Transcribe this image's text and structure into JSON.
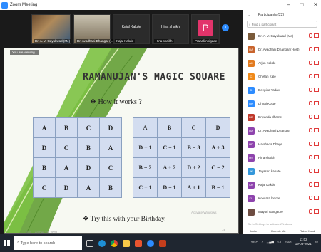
{
  "window": {
    "title": "Zoom Meeting"
  },
  "video_strip": {
    "tiles": [
      {
        "name": "Dr. A. V. Gayakwad (Me)"
      },
      {
        "name": "Dr. Avadhani Dhangar (..."
      },
      {
        "name": "Kajal Kakde",
        "caption": "Kajal Kakde"
      },
      {
        "name": "Hina shaikh",
        "caption": "Hina shaikh"
      },
      {
        "name": "Pranali nnigade",
        "avatar_letter": "P"
      }
    ]
  },
  "share_label": "You are viewing...",
  "slide": {
    "title": "RAMANUJAN'S MAGIC SQUARE",
    "subtitle": "❖ How it works ?",
    "grid_left": [
      [
        "A",
        "B",
        "C",
        "D"
      ],
      [
        "D",
        "C",
        "B",
        "A"
      ],
      [
        "B",
        "A",
        "D",
        "C"
      ],
      [
        "C",
        "D",
        "A",
        "B"
      ]
    ],
    "grid_right": [
      [
        "A",
        "B",
        "C",
        "D"
      ],
      [
        "D + 1",
        "C − 1",
        "B − 3",
        "A + 3"
      ],
      [
        "B − 2",
        "A + 2",
        "D + 2",
        "C − 2"
      ],
      [
        "C + 1",
        "D − 1",
        "A + 1",
        "B − 1"
      ]
    ],
    "footer_note": "❖ Try this with your Birthday.",
    "date": "Sat   ...  ember 19, 2021",
    "page_number": "19",
    "watermark": "Activate Windows"
  },
  "participants": {
    "header": "Participants (22)",
    "search_placeholder": "Find a participant",
    "list": [
      {
        "name": "Dr. A. V. Gayakwad (Me)",
        "initials": "",
        "color": "#7a5a3a"
      },
      {
        "name": "Dr. Avadhani Dhangar (Host)",
        "initials": "DA",
        "color": "#c8642d"
      },
      {
        "name": "Arjun Kakde",
        "initials": "AK",
        "color": "#e27b1f"
      },
      {
        "name": "Chetan Kale",
        "initials": "C",
        "color": "#f08a1a"
      },
      {
        "name": "Deepika Yadav",
        "initials": "D",
        "color": "#2d8cff"
      },
      {
        "name": "Dhiraj Koste",
        "initials": "DK",
        "color": "#2d8cff"
      },
      {
        "name": "Dnyanda dhame",
        "initials": "DD",
        "color": "#c0392b"
      },
      {
        "name": "Dr. Avadhani Dhangar",
        "initials": "DA",
        "color": "#8e44ad"
      },
      {
        "name": "Harshada Dhage",
        "initials": "HD",
        "color": "#8e44ad"
      },
      {
        "name": "Hina shaikh",
        "initials": "HS",
        "color": "#8e44ad"
      },
      {
        "name": "Jayashri kahate",
        "initials": "JK",
        "color": "#3498db"
      },
      {
        "name": "Kajal Kakde",
        "initials": "KK",
        "color": "#8e44ad"
      },
      {
        "name": "Koosara lonore",
        "initials": "KL",
        "color": "#8e44ad"
      },
      {
        "name": "Mayuri Gangaure",
        "initials": "",
        "color": "#6d4c41"
      }
    ],
    "footer_buttons": [
      "Invite",
      "Unmute Me",
      "Raise Hand"
    ],
    "activate_note": "Go to Settings to activate Windows."
  },
  "taskbar": {
    "search_placeholder": "Type here to search",
    "weather": "23°C",
    "language": "ENG",
    "time": "11:02",
    "date": "19-03-2021",
    "icons": [
      "task-view-icon",
      "edge-icon",
      "chrome-icon",
      "file-explorer-icon",
      "store-icon",
      "zoom-icon",
      "powerpoint-icon"
    ]
  },
  "colors": {
    "grid_fill": "#d3ddf0",
    "grid_border": "#8aa0c0",
    "taskbar": "#1f2630",
    "zoom_blue": "#2d8cff"
  }
}
